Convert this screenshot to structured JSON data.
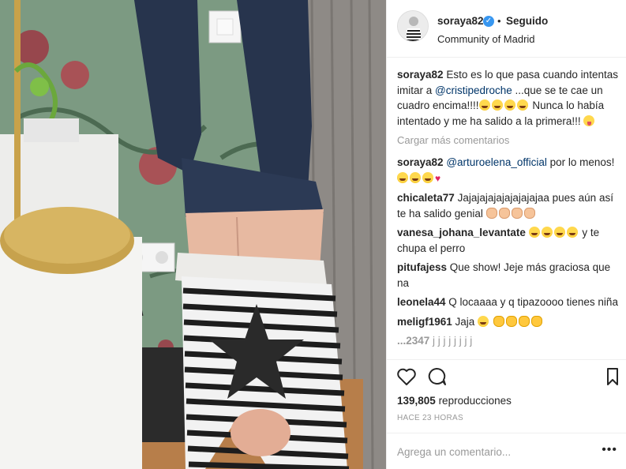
{
  "post": {
    "username": "soraya82",
    "follow_state": "Seguido",
    "separator": "•",
    "verified_mark": "✓",
    "location": "Community of Madrid"
  },
  "caption": {
    "user": "soraya82",
    "text_before": " Esto es lo que pasa cuando intentas imitar a ",
    "mention": "@cristipedroche",
    "text_after": " ...que se te cae un cuadro encima!!!!",
    "line2": " Nunca lo había intentado y me ha salido a la primera!!! "
  },
  "load_more": "Cargar más comentarios",
  "comments": [
    {
      "user": "soraya82",
      "mention": "@arturoelena_official",
      "text": " por lo menos! "
    },
    {
      "user": "chicaleta77",
      "text": " Jajajajajajajajajajaa pues aún así te ha salido genial "
    },
    {
      "user": "vanesa_johana_levantate",
      "text_tail": " y te chupa el perro"
    },
    {
      "user": "pitufajess",
      "text": " Que show! Jeje más graciosa que na"
    },
    {
      "user": "leonela44",
      "text": " Q locaaaa y q tipazoooo tienes niña"
    },
    {
      "user": "meligf1961",
      "text": " Jaja "
    },
    {
      "user": "...2347",
      "text": " j j j j j j j j"
    }
  ],
  "stats": {
    "views_count": "139,805",
    "views_label": " reproducciones",
    "time_ago": "HACE 23 HORAS"
  },
  "composer": {
    "placeholder": "Agrega un comentario...",
    "more_label": "•••"
  },
  "icons": {
    "like": "heart-outline-icon",
    "comment": "speech-bubble-icon",
    "save": "bookmark-icon",
    "verified": "verified-badge-icon"
  },
  "colors": {
    "accent_blue": "#3897f0",
    "mention": "#003569",
    "muted": "#999999",
    "text": "#262626"
  }
}
